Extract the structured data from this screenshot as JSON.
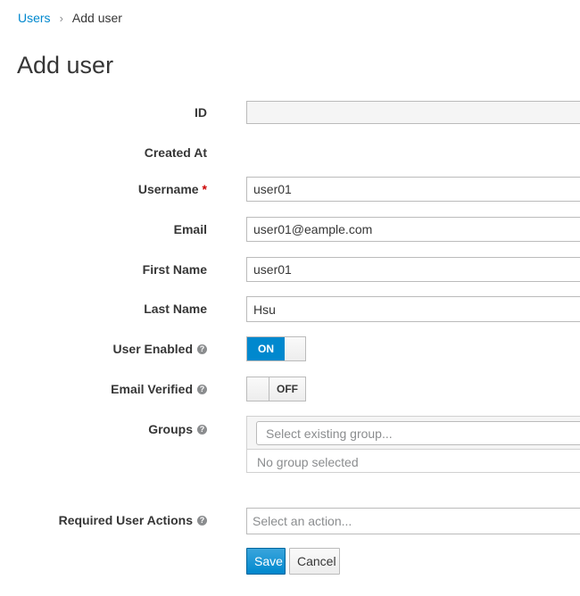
{
  "breadcrumb": {
    "parent": "Users",
    "separator": "›",
    "current": "Add user"
  },
  "page_title": "Add user",
  "form": {
    "id": {
      "label": "ID",
      "value": ""
    },
    "created_at": {
      "label": "Created At",
      "value": ""
    },
    "username": {
      "label": "Username",
      "required_marker": "*",
      "value": "user01"
    },
    "email": {
      "label": "Email",
      "value": "user01@eample.com"
    },
    "first_name": {
      "label": "First Name",
      "value": "user01"
    },
    "last_name": {
      "label": "Last Name",
      "value": "Hsu"
    },
    "user_enabled": {
      "label": "User Enabled",
      "state": "ON"
    },
    "email_verified": {
      "label": "Email Verified",
      "state": "OFF"
    },
    "groups": {
      "label": "Groups",
      "placeholder": "Select existing group...",
      "empty_text": "No group selected"
    },
    "required_actions": {
      "label": "Required User Actions",
      "placeholder": "Select an action..."
    }
  },
  "buttons": {
    "save": "Save",
    "cancel": "Cancel"
  },
  "icons": {
    "help": "question-circle-icon"
  },
  "colors": {
    "accent": "#0088ce",
    "required": "#cc0000"
  }
}
